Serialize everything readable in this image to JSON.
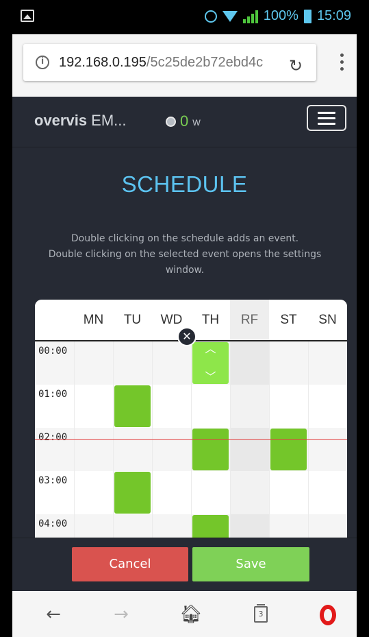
{
  "status_bar": {
    "battery": "100%",
    "time": "15:09"
  },
  "browser": {
    "url_host": "192.168.0.195",
    "url_path": "/5c25de2b72ebd4c"
  },
  "header": {
    "brand_bold": "overvis",
    "brand_rest": " EM...",
    "power_value": "0",
    "power_unit": "w"
  },
  "page": {
    "title": "SCHEDULE",
    "hint_line1": "Double clicking on the schedule adds an event.",
    "hint_line2": "Double clicking on the selected event opens the settings window."
  },
  "schedule": {
    "days": [
      "MN",
      "TU",
      "WD",
      "TH",
      "RF",
      "ST",
      "SN"
    ],
    "times": [
      "00:00",
      "01:00",
      "02:00",
      "03:00",
      "04:00"
    ],
    "current_time_marker": "02:15",
    "events": [
      {
        "day": "TH",
        "start": "00:00",
        "end": "01:00",
        "selected": true
      },
      {
        "day": "TU",
        "start": "01:00",
        "end": "02:00",
        "selected": false
      },
      {
        "day": "TH",
        "start": "02:00",
        "end": "03:00",
        "selected": false
      },
      {
        "day": "ST",
        "start": "02:00",
        "end": "03:00",
        "selected": false
      },
      {
        "day": "TU",
        "start": "03:00",
        "end": "04:00",
        "selected": false
      },
      {
        "day": "TH",
        "start": "04:00",
        "end": "05:00",
        "selected": false
      }
    ]
  },
  "actions": {
    "cancel": "Cancel",
    "save": "Save"
  },
  "bottom_nav": {
    "tab_count": "3"
  },
  "colors": {
    "accent": "#5cc3f0",
    "event": "#74c62a",
    "event_selected": "#8ee64a",
    "cancel": "#d9534f",
    "save": "#7fd157",
    "now_line": "#e24040"
  }
}
